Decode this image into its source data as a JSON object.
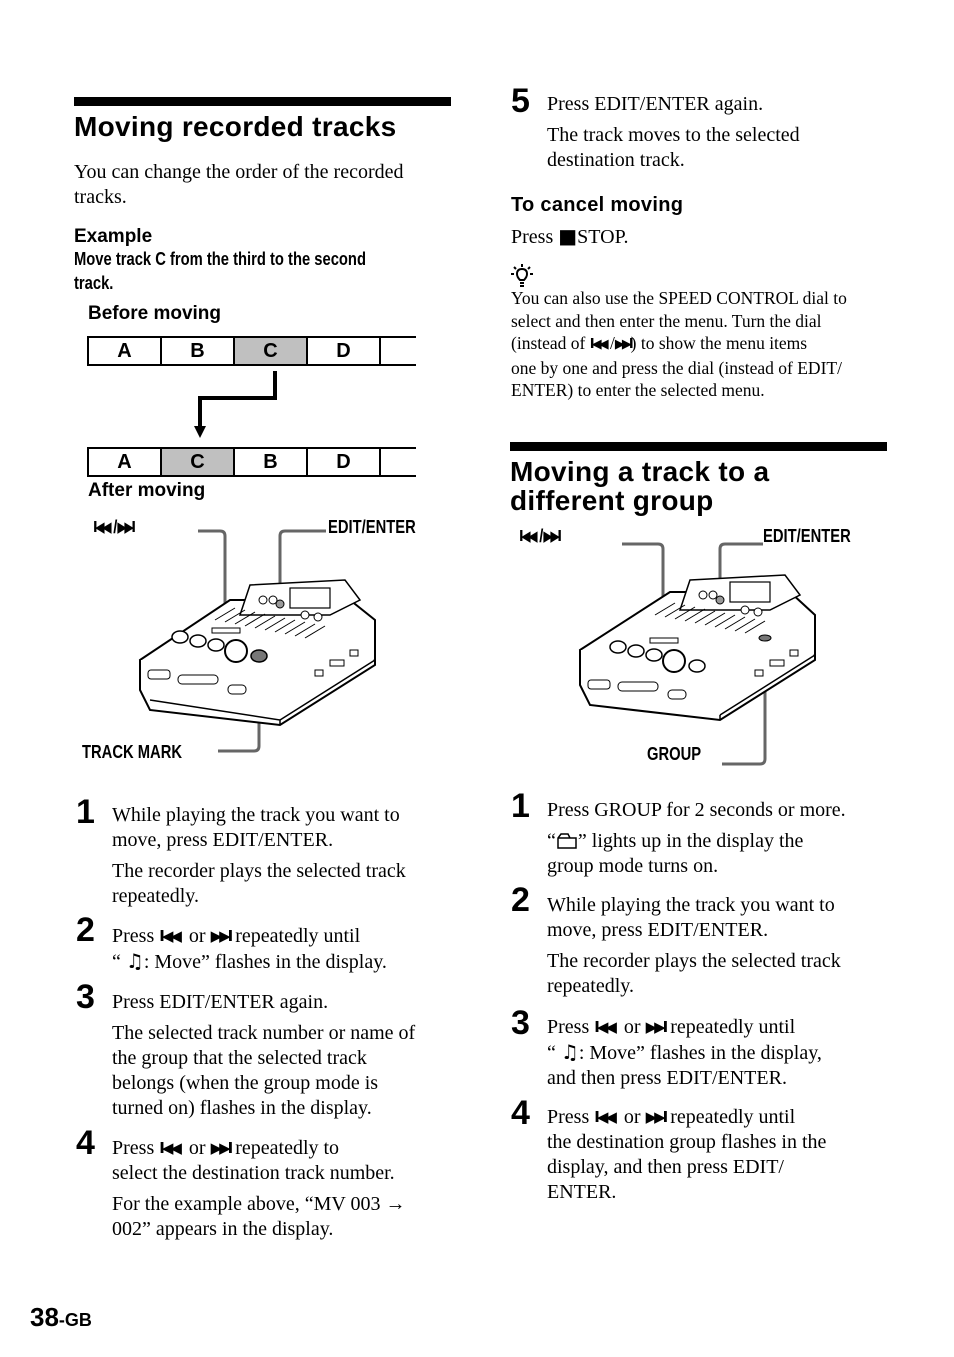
{
  "left": {
    "title": "Moving recorded tracks",
    "intro": "You can change the order of the recorded tracks.",
    "example_label": "Example",
    "example_text_line1": "Move track C from the third to the second",
    "example_text_line2": "track.",
    "before_label": "Before moving",
    "after_label": "After moving",
    "before_tracks": [
      "A",
      "B",
      "C",
      "D",
      ""
    ],
    "after_tracks": [
      "A",
      "C",
      "B",
      "D",
      ""
    ],
    "highlight_color": "#c0c0c0",
    "figure_labels": {
      "skip": "I◀◀ /▶▶I",
      "edit_enter": "EDIT/ENTER",
      "track_mark": "TRACK MARK"
    },
    "steps": [
      {
        "num": "1",
        "line1": "While playing the track you want to",
        "line2": "move, press EDIT/ENTER.",
        "note1": "The recorder plays the selected track",
        "note2": "repeatedly."
      },
      {
        "num": "2",
        "pre": "Press",
        "mid": "or",
        "post": "repeatedly until",
        "line2_open": "“",
        "line2_rest": ": Move” flashes in the display."
      },
      {
        "num": "3",
        "line1": "Press EDIT/ENTER again.",
        "note1": "The selected track number or name of",
        "note2": "the group that the selected track",
        "note3": "belongs (when the group mode is",
        "note4": "turned on) flashes in the display."
      },
      {
        "num": "4",
        "pre": "Press",
        "mid": "or",
        "post": "repeatedly to",
        "line2": "select the destination track number.",
        "note1": "For the example above, “MV 003 →",
        "note2": "002” appears in the display."
      }
    ]
  },
  "right": {
    "step5": {
      "num": "5",
      "line1": "Press EDIT/ENTER again.",
      "note1": "The track moves to the selected",
      "note2": "destination track."
    },
    "cancel_heading": "To cancel moving",
    "cancel_pre": "Press",
    "cancel_post": "STOP.",
    "tip_lines": [
      "You can also use the SPEED CONTROL dial to",
      "select and then enter the menu. Turn the dial",
      "(instead of",
      ") to show the menu items",
      "one by one and press the dial (instead of EDIT/",
      "ENTER) to enter the selected menu."
    ],
    "title_line1": "Moving a track to a",
    "title_line2": "different group",
    "figure_labels": {
      "skip": "I◀◀ /▶▶I",
      "edit_enter": "EDIT/ENTER",
      "group": "GROUP"
    },
    "steps": [
      {
        "num": "1",
        "line1": "Press GROUP for 2 seconds or more.",
        "note1_open": "“",
        "note1_rest": "” lights up in the display the",
        "note2": "group mode turns on."
      },
      {
        "num": "2",
        "line1": "While playing the track you want to",
        "line2": "move, press EDIT/ENTER.",
        "note1": "The recorder plays the selected track",
        "note2": "repeatedly."
      },
      {
        "num": "3",
        "pre": "Press",
        "mid": "or",
        "post": "repeatedly until",
        "line2_open": "“",
        "line2_rest": ": Move” flashes in the display,",
        "line3": "and then press EDIT/ENTER."
      },
      {
        "num": "4",
        "pre": "Press",
        "mid": "or",
        "post": "repeatedly until",
        "line2": "the destination group flashes in the",
        "line3": "display, and then press EDIT/",
        "line4": "ENTER."
      }
    ]
  },
  "footer": {
    "page_number": "38",
    "suffix": "-GB"
  },
  "glyphs": {
    "prev": "I◀◀",
    "next": "▶▶I",
    "stop": "■"
  }
}
